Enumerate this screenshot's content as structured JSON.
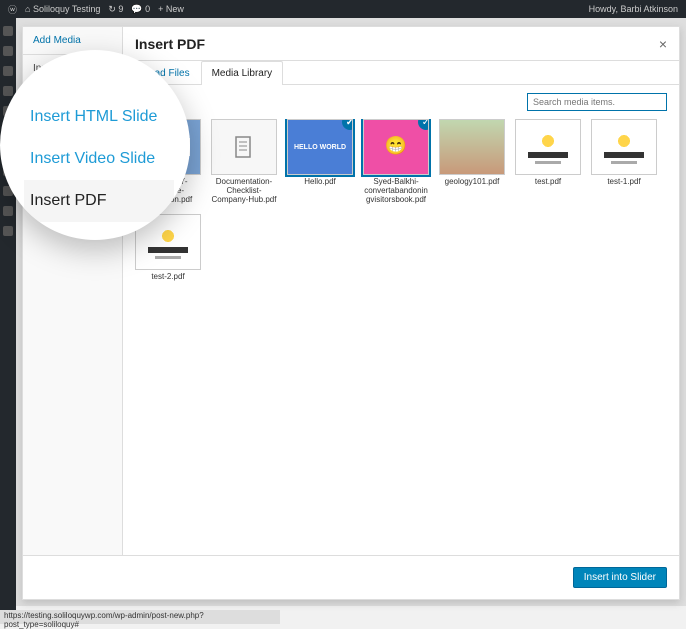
{
  "admin_bar": {
    "site": "Soliloquy Testing",
    "comments": "0",
    "new": "New",
    "howdy": "Howdy, Barbi Atkinson"
  },
  "modal": {
    "sidebar": {
      "items": [
        {
          "label": "Add Media"
        },
        {
          "label": "Insert Image Slide"
        },
        {
          "label": "Insert HTML Slide"
        },
        {
          "label": "Insert Video Slide"
        },
        {
          "label": "Insert PDF"
        }
      ]
    },
    "title": "Insert PDF",
    "tabs": [
      {
        "label": "Upload Files"
      },
      {
        "label": "Media Library"
      }
    ],
    "search": {
      "placeholder": "Search media items."
    },
    "footer": {
      "button": "Insert into Slider"
    }
  },
  "magnifier": {
    "items": [
      "Insert HTML Slide",
      "Insert Video Slide",
      "Insert PDF"
    ]
  },
  "files": [
    {
      "label": "CLC-2017-Signage-Collection.pdf",
      "kind": "doc"
    },
    {
      "label": "Documentation-Checklist-Company-Hub.pdf",
      "kind": "docicon"
    },
    {
      "label": "Hello.pdf",
      "kind": "hello",
      "selected": true,
      "thumbText": "HELLO WORLD"
    },
    {
      "label": "Syed-Balkhi-convertabandoningvisitorsbook.pdf",
      "kind": "pink",
      "selected": true
    },
    {
      "label": "geology101.pdf",
      "kind": "geo"
    },
    {
      "label": "test.pdf",
      "kind": "tst"
    },
    {
      "label": "test-1.pdf",
      "kind": "tst"
    },
    {
      "label": "test-2.pdf",
      "kind": "tst"
    }
  ],
  "statusbar": "https://testing.soliloquywp.com/wp-admin/post-new.php?post_type=soliloquy#"
}
